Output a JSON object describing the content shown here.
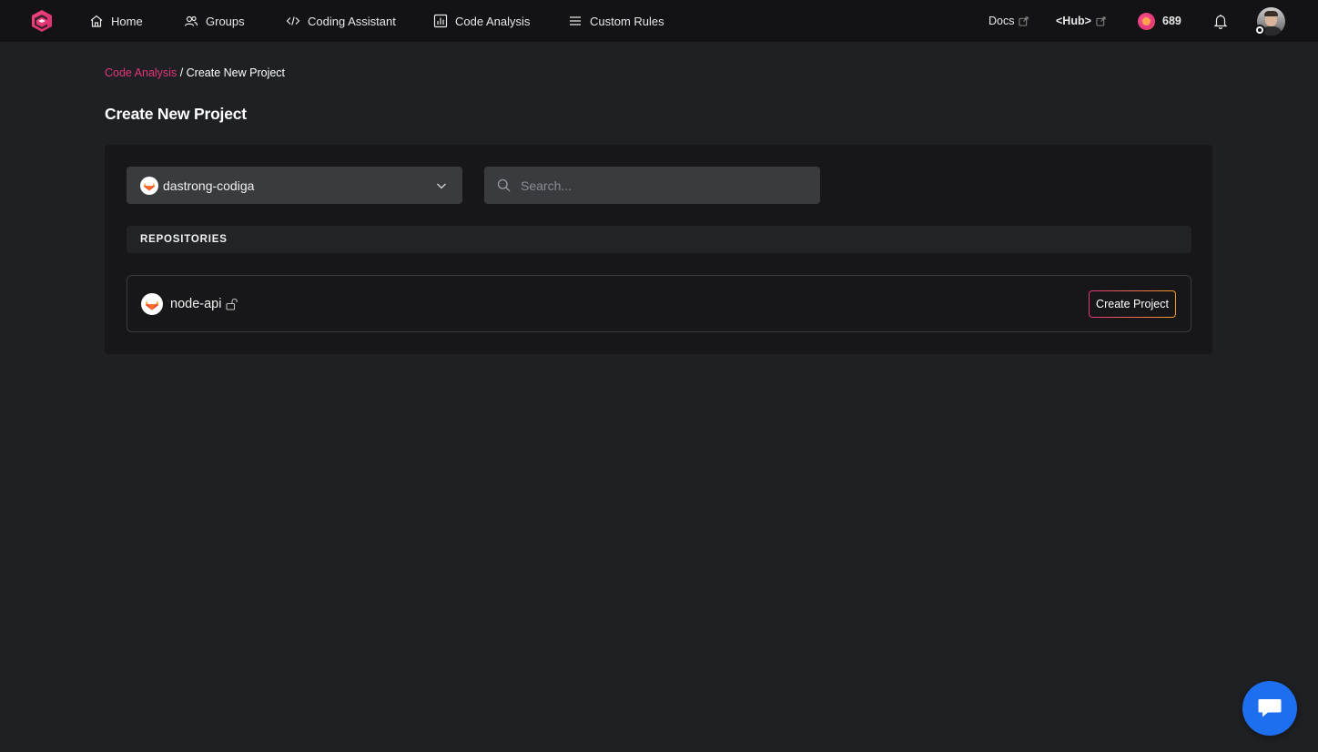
{
  "nav": {
    "items": [
      {
        "label": "Home",
        "icon": "home-icon"
      },
      {
        "label": "Groups",
        "icon": "users-icon"
      },
      {
        "label": "Coding Assistant",
        "icon": "code-icon"
      },
      {
        "label": "Code Analysis",
        "icon": "bar-chart-icon"
      },
      {
        "label": "Custom Rules",
        "icon": "list-icon"
      }
    ],
    "docs_label": "Docs",
    "hub_label": "<Hub>",
    "points": "689"
  },
  "breadcrumb": {
    "parent": "Code Analysis",
    "separator": " / ",
    "current": "Create New Project"
  },
  "page": {
    "title": "Create New Project"
  },
  "org_select": {
    "value": "dastrong-codiga"
  },
  "search": {
    "placeholder": "Search..."
  },
  "repositories": {
    "header": "REPOSITORIES",
    "items": [
      {
        "name": "node-api",
        "button_label": "Create Project"
      }
    ]
  },
  "colors": {
    "accent": "#e2367b",
    "accent_end": "#f59c2a",
    "chat": "#1e6ff0",
    "background": "#1f2023",
    "topbar": "#131315"
  }
}
